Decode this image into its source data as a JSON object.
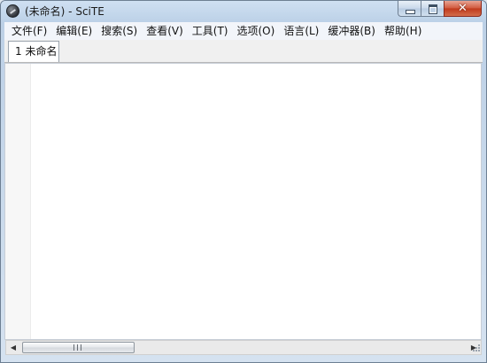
{
  "window": {
    "title": "(未命名) - SciTE",
    "icon": "scite-app-icon",
    "caption_buttons": {
      "minimize_icon": "minimize-icon",
      "maximize_icon": "maximize-icon",
      "close_glyph": "✕"
    }
  },
  "menubar": {
    "items": [
      {
        "label": "文件(F)"
      },
      {
        "label": "编辑(E)"
      },
      {
        "label": "搜索(S)"
      },
      {
        "label": "查看(V)"
      },
      {
        "label": "工具(T)"
      },
      {
        "label": "选项(O)"
      },
      {
        "label": "语言(L)"
      },
      {
        "label": "缓冲器(B)"
      },
      {
        "label": "帮助(H)"
      }
    ]
  },
  "tabs": [
    {
      "label": "1 未命名",
      "active": true
    }
  ],
  "editor": {
    "content": ""
  },
  "scrollbar": {
    "left_arrow": "◀",
    "right_arrow": "▶"
  },
  "colors": {
    "close_button": "#c0391b",
    "editor_background": "#ffffff",
    "frame": "#bcd1e7"
  }
}
